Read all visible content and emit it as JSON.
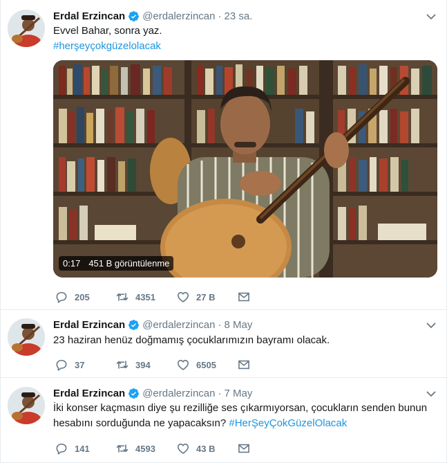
{
  "colors": {
    "accent": "#1b95e0",
    "muted": "#657786",
    "text": "#14171a",
    "border": "#e6ecf0"
  },
  "tweets": [
    {
      "name": "Erdal Erzincan",
      "handle": "@erdalerzincan",
      "separator": "·",
      "time": "23 sa.",
      "text_lines": [
        "Evvel Bahar, sonra yaz."
      ],
      "hashtag": "#herşeyçokgüzelolacak",
      "video": {
        "duration": "0:17",
        "views": "451 B görüntülenme"
      },
      "stats": {
        "replies": "205",
        "retweets": "4351",
        "likes": "27 B"
      }
    },
    {
      "name": "Erdal Erzincan",
      "handle": "@erdalerzincan",
      "separator": "·",
      "time": "8 May",
      "text_lines": [
        "23 haziran henüz doğmamış çocuklarımızın bayramı olacak."
      ],
      "stats": {
        "replies": "37",
        "retweets": "394",
        "likes": "6505"
      }
    },
    {
      "name": "Erdal Erzincan",
      "handle": "@erdalerzincan",
      "separator": "·",
      "time": "7 May",
      "text_lines": [
        "İki konser kaçmasın diye şu rezilliğe ses çıkarmıyorsan, çocukların senden bunun",
        "hesabını sorduğunda ne yapacaksın?"
      ],
      "hashtag": "#HerŞeyÇokGüzelOlacak",
      "stats": {
        "replies": "141",
        "retweets": "4593",
        "likes": "43 B"
      }
    }
  ]
}
